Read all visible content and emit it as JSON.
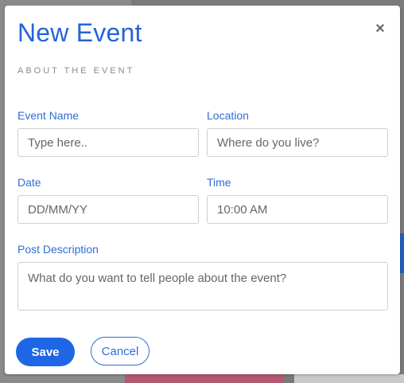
{
  "modal": {
    "title": "New Event",
    "close_symbol": "×",
    "subtitle": "ABOUT THE EVENT"
  },
  "form": {
    "event_name": {
      "label": "Event Name",
      "placeholder": "Type here.."
    },
    "location": {
      "label": "Location",
      "placeholder": "Where do you live?"
    },
    "date": {
      "label": "Date",
      "placeholder": "DD/MM/YY"
    },
    "time": {
      "label": "Time",
      "value": "10:00 AM"
    },
    "post_description": {
      "label": "Post Description",
      "placeholder": "What do you want to tell people about the event?"
    }
  },
  "buttons": {
    "save": "Save",
    "cancel": "Cancel"
  },
  "colors": {
    "accent": "#2563d9",
    "button_primary": "#1f66e6"
  },
  "icons": {
    "close": "close-icon"
  }
}
